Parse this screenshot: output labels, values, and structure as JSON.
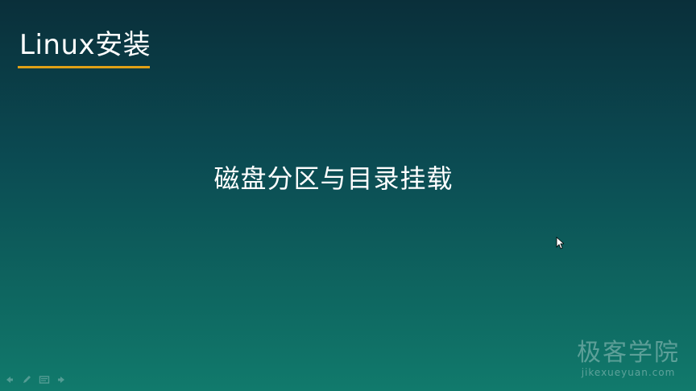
{
  "slide": {
    "title": "Linux安装",
    "subtitle": "磁盘分区与目录挂载"
  },
  "watermark": {
    "name": "极客学院",
    "url": "jikexueyuan.com"
  },
  "icons": [
    "arrow-left-icon",
    "pen-icon",
    "slides-icon",
    "arrow-right-icon",
    "mouse-pointer-icon"
  ],
  "colors": {
    "background_top": "#0a2f3a",
    "background_bottom": "#117a6c",
    "title_underline": "#e0a016",
    "text": "#ffffff"
  }
}
